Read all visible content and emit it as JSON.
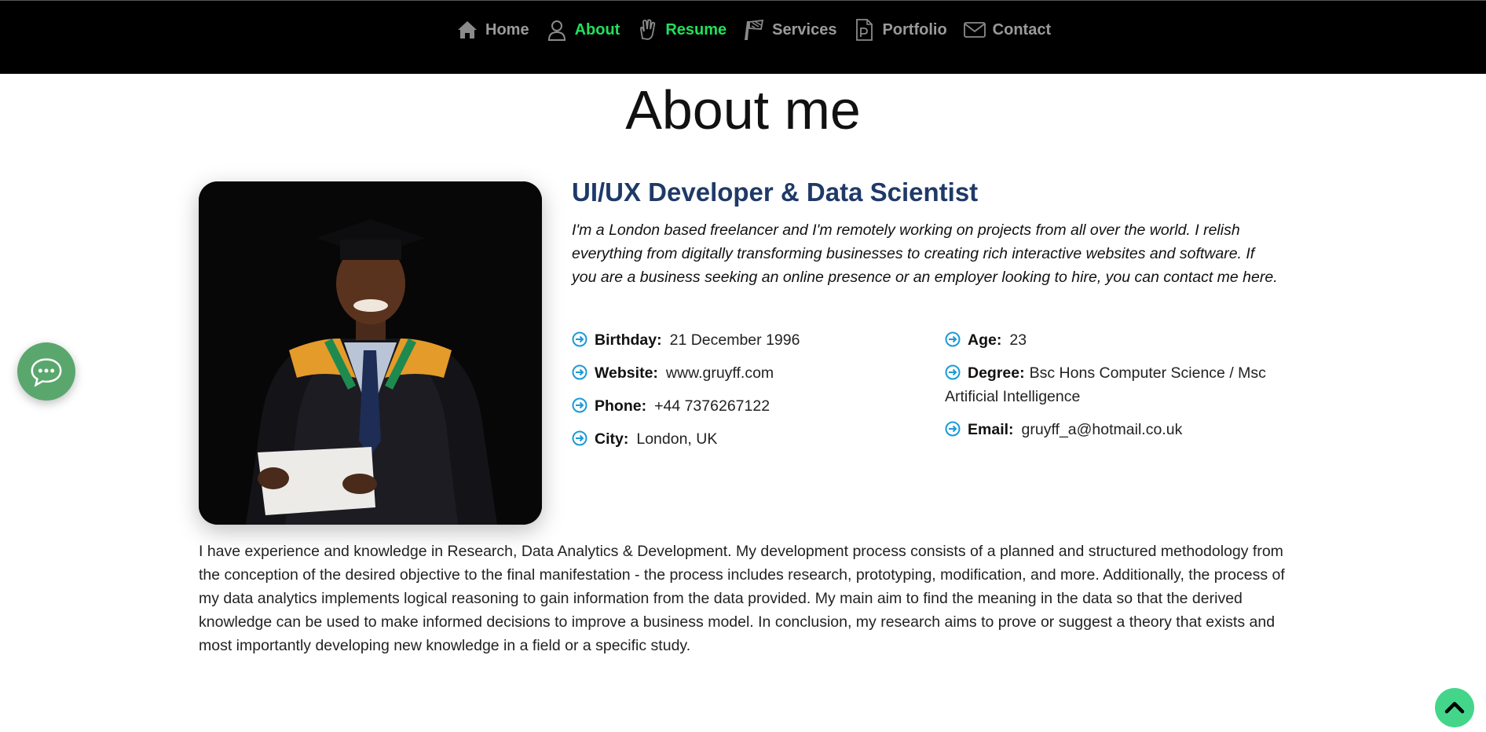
{
  "nav": {
    "items": [
      {
        "label": "Home",
        "icon": "home-icon",
        "active": false
      },
      {
        "label": "About",
        "icon": "user-icon",
        "active": true
      },
      {
        "label": "Resume",
        "icon": "hand-icon",
        "active": true
      },
      {
        "label": "Services",
        "icon": "brush-icon",
        "active": false
      },
      {
        "label": "Portfolio",
        "icon": "portfolio-icon",
        "active": false
      },
      {
        "label": "Contact",
        "icon": "envelope-icon",
        "active": false
      }
    ],
    "active_color": "#22e05a",
    "inactive_color": "#9a9a9a"
  },
  "page": {
    "title": "About me"
  },
  "profile": {
    "photo_alt": "graduation-portrait",
    "role": "UI/UX Developer & Data Scientist",
    "intro": "I'm a London based freelancer and I'm remotely working on projects from all over the world. I relish everything from digitally transforming businesses to creating rich interactive websites and software. If you are a business seeking an online presence or an employer looking to hire, you can contact me here.",
    "left_details": [
      {
        "label": "Birthday:",
        "value": "21 December 1996"
      },
      {
        "label": "Website:",
        "value": "www.gruyff.com"
      },
      {
        "label": "Phone:",
        "value": "+44 7376267122"
      },
      {
        "label": "City:",
        "value": "London, UK"
      }
    ],
    "right_details": [
      {
        "label": "Age:",
        "value": "23"
      },
      {
        "label": "Degree:",
        "value": "Bsc Hons Computer Science / Msc Artificial Intelligence"
      },
      {
        "label": "Email:",
        "value": "gruyff_a@hotmail.co.uk"
      }
    ],
    "bio": "I have experience and knowledge in Research, Data Analytics & Development. My development process consists of a planned and structured methodology from the conception of the desired objective to the final manifestation - the process includes research, prototyping, modification, and more. Additionally, the process of my data analytics implements logical reasoning to gain information from the data provided. My main aim to find the meaning in the data so that the derived knowledge can be used to make informed decisions to improve a business model. In conclusion, my research aims to prove or suggest a theory that exists and most importantly developing new knowledge in a field or a specific study."
  },
  "widgets": {
    "chat_icon": "chat-bubble-icon",
    "back_to_top_icon": "chevron-up-icon",
    "accent_title_color": "#1f3a68",
    "arrow_color": "#1a9ad6"
  }
}
